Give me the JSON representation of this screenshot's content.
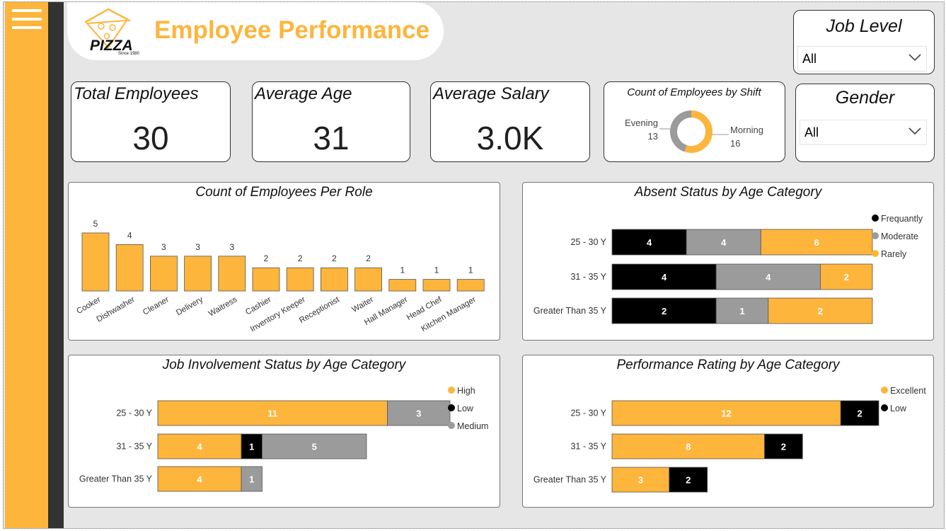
{
  "header": {
    "title": "Employee Performance",
    "logo_text": "PIZZA",
    "logo_sub": "Since 1980"
  },
  "kpis": [
    {
      "label": "Total Employees",
      "value": "30"
    },
    {
      "label": "Average Age",
      "value": "31"
    },
    {
      "label": "Average Salary",
      "value": "3.0K"
    }
  ],
  "filters": {
    "job_level": {
      "label": "Job Level",
      "value": "All"
    },
    "gender": {
      "label": "Gender",
      "value": "All"
    }
  },
  "colors": {
    "accent": "#fdb53c",
    "dark": "#000000",
    "grey": "#9b9b9b",
    "rail_dark": "#333333",
    "background": "#e6e6e6"
  },
  "chart_data": [
    {
      "type": "pie",
      "variant": "donut",
      "title": "Count of Employees by Shift",
      "categories": [
        "Morning",
        "Evening"
      ],
      "values": [
        16,
        13
      ],
      "colors": [
        "#fdb53c",
        "#9b9b9b"
      ]
    },
    {
      "type": "bar",
      "title": "Count of Employees Per Role",
      "categories": [
        "Cooker",
        "Dishwasher",
        "Cleaner",
        "Delivery",
        "Waitress",
        "Cashier",
        "Inventory Keeper",
        "Receptionist",
        "Waiter",
        "Hall Manager",
        "Head Chef",
        "Kitchen Manager"
      ],
      "values": [
        5,
        4,
        3,
        3,
        3,
        2,
        2,
        2,
        2,
        1,
        1,
        1
      ],
      "color": "#fdb53c"
    },
    {
      "type": "bar",
      "orientation": "horizontal",
      "stacked": true,
      "title": "Absent Status by Age Category",
      "categories": [
        "25 - 30 Y",
        "31 - 35 Y",
        "Greater Than 35 Y"
      ],
      "series": [
        {
          "name": "Frequantly",
          "values": [
            4,
            4,
            2
          ],
          "color": "#000000"
        },
        {
          "name": "Moderate",
          "values": [
            4,
            4,
            1
          ],
          "color": "#9b9b9b"
        },
        {
          "name": "Rarely",
          "values": [
            6,
            2,
            2
          ],
          "color": "#fdb53c"
        }
      ],
      "legend": "top-right"
    },
    {
      "type": "bar",
      "orientation": "horizontal",
      "stacked": true,
      "title": "Job Involvement Status by Age Category",
      "categories": [
        "25 - 30 Y",
        "31 - 35 Y",
        "Greater Than 35 Y"
      ],
      "series": [
        {
          "name": "High",
          "values": [
            11,
            4,
            4
          ],
          "color": "#fdb53c"
        },
        {
          "name": "Low",
          "values": [
            0,
            1,
            0
          ],
          "color": "#000000"
        },
        {
          "name": "Medium",
          "values": [
            3,
            5,
            1
          ],
          "color": "#9b9b9b"
        }
      ],
      "legend": "top-right"
    },
    {
      "type": "bar",
      "orientation": "horizontal",
      "stacked": true,
      "title": "Performance Rating by Age Category",
      "categories": [
        "25 - 30 Y",
        "31 - 35 Y",
        "Greater Than 35 Y"
      ],
      "series": [
        {
          "name": "Excellent",
          "values": [
            12,
            8,
            3
          ],
          "color": "#fdb53c"
        },
        {
          "name": "Low",
          "values": [
            2,
            2,
            2
          ],
          "color": "#000000"
        }
      ],
      "legend": "top-right"
    }
  ]
}
